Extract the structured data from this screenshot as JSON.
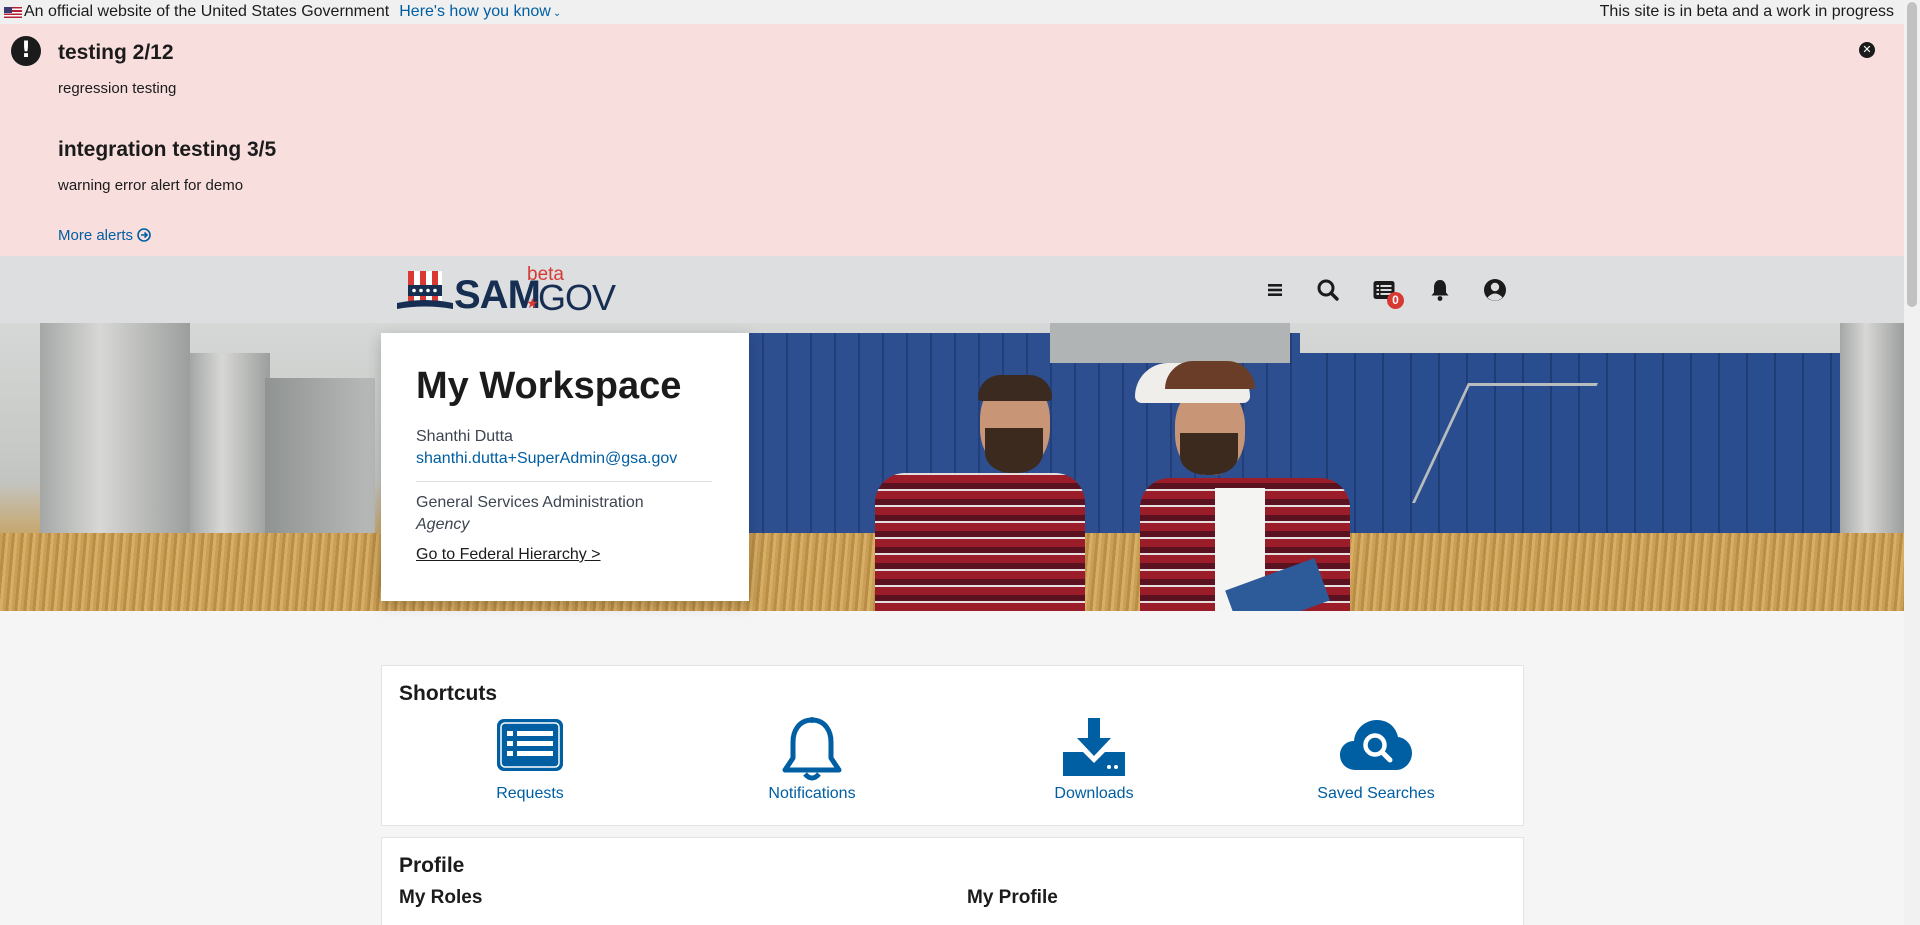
{
  "gov_banner": {
    "official_text": "An official website of the United States Government",
    "how_link": "Here's how you know",
    "beta_notice": "This site is in beta and a work in progress"
  },
  "alerts": {
    "items": [
      {
        "title": "testing 2/12",
        "body": "regression testing"
      },
      {
        "title": "integration testing 3/5",
        "body": "warning error alert for demo"
      }
    ],
    "more_link": "More alerts"
  },
  "header": {
    "logo_sam": "SAM",
    "logo_gov": "GOV",
    "logo_beta": "beta",
    "notification_count": "0",
    "icons": [
      "menu-icon",
      "search-icon",
      "requests-icon",
      "bell-icon",
      "user-icon"
    ]
  },
  "workspace": {
    "title": "My Workspace",
    "user_name": "Shanthi Dutta",
    "user_email": "shanthi.dutta+SuperAdmin@gsa.gov",
    "organization": "General Services Administration",
    "org_type": "Agency",
    "hierarchy_link": "Go to Federal Hierarchy >"
  },
  "shortcuts": {
    "title": "Shortcuts",
    "items": [
      {
        "label": "Requests",
        "icon": "list-icon"
      },
      {
        "label": "Notifications",
        "icon": "bell-icon"
      },
      {
        "label": "Downloads",
        "icon": "download-icon"
      },
      {
        "label": "Saved Searches",
        "icon": "cloud-search-icon"
      }
    ]
  },
  "profile": {
    "title": "Profile",
    "my_roles": "My Roles",
    "my_profile": "My Profile"
  },
  "colors": {
    "link": "#005ea2",
    "alert_bg": "#f9dede",
    "header_bg": "#dcdee0",
    "brand_navy": "#162e51",
    "brand_red": "#d83933"
  }
}
